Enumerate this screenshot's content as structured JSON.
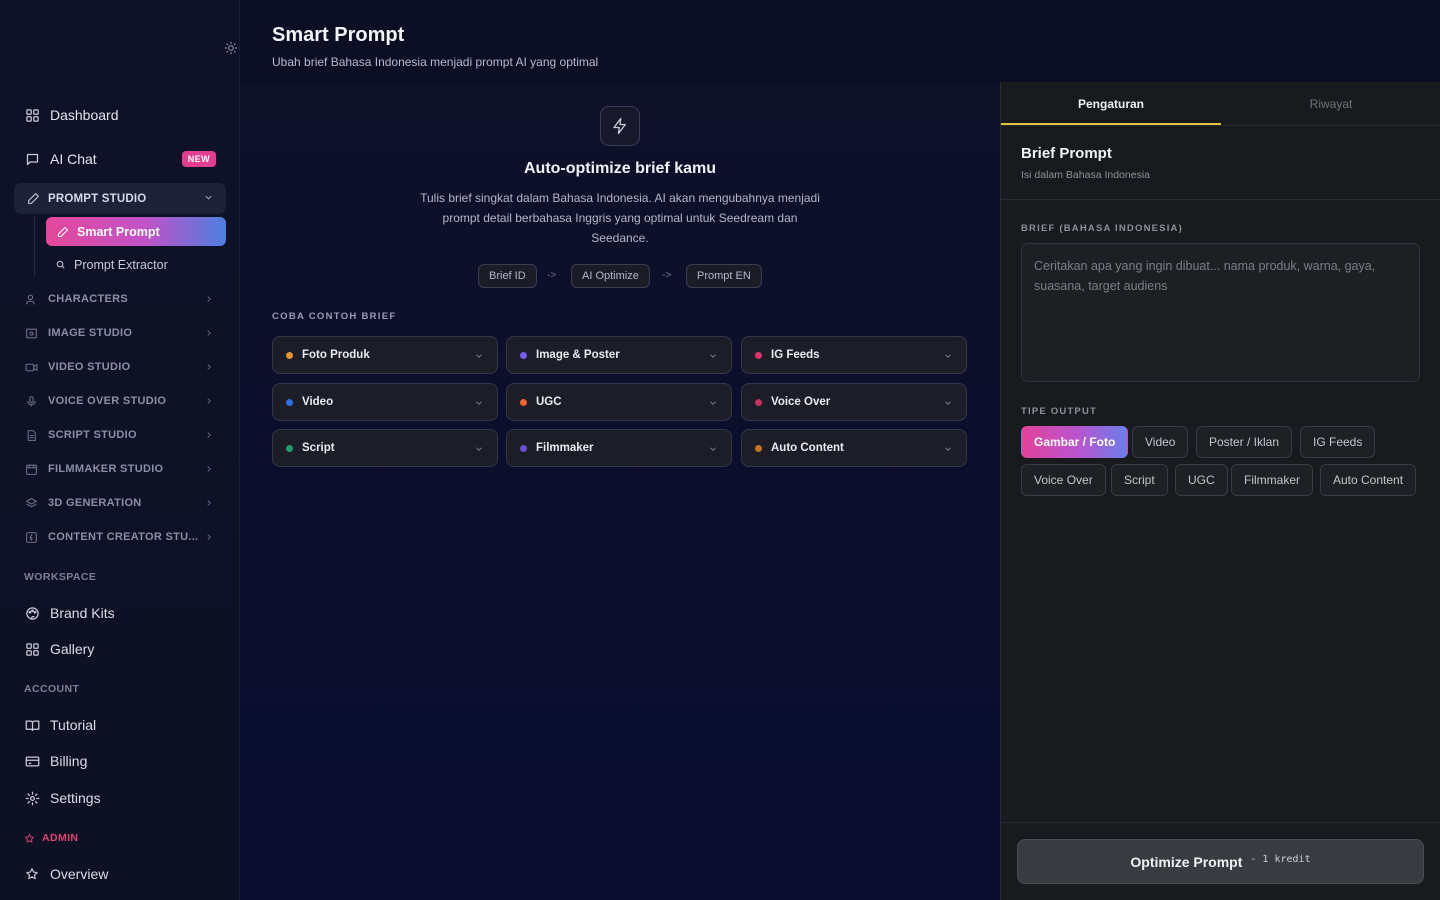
{
  "sidebar": {
    "top_items": [
      {
        "label": "Dashboard",
        "icon": "grid-icon"
      },
      {
        "label": "AI Chat",
        "icon": "chat-icon",
        "badge": "NEW"
      }
    ],
    "open_section": {
      "label": "PROMPT STUDIO",
      "children": [
        {
          "label": "Smart Prompt",
          "active": true
        },
        {
          "label": "Prompt Extractor"
        }
      ]
    },
    "sections": [
      "CHARACTERS",
      "IMAGE STUDIO",
      "VIDEO STUDIO",
      "VOICE OVER STUDIO",
      "SCRIPT STUDIO",
      "FILMMAKER STUDIO",
      "3D GENERATION",
      "CONTENT CREATOR STU..."
    ],
    "workspace": {
      "label": "WORKSPACE",
      "items": [
        "Brand Kits",
        "Gallery"
      ]
    },
    "account": {
      "label": "ACCOUNT",
      "items": [
        "Tutorial",
        "Billing",
        "Settings"
      ]
    },
    "admin": {
      "label": "ADMIN",
      "items": [
        "Overview"
      ]
    }
  },
  "header": {
    "title": "Smart Prompt",
    "subtitle": "Ubah brief Bahasa Indonesia menjadi prompt AI yang optimal"
  },
  "hero": {
    "title": "Auto-optimize brief kamu",
    "description": "Tulis brief singkat dalam Bahasa Indonesia. AI akan mengubahnya menjadi prompt detail berbahasa Inggris yang optimal untuk Seedream dan Seedance.",
    "flow": [
      "Brief ID",
      "AI Optimize",
      "Prompt EN"
    ],
    "flow_arrow": "->"
  },
  "examples": {
    "label": "COBA CONTOH BRIEF",
    "cards": [
      {
        "label": "Foto Produk",
        "color": "#e0952f"
      },
      {
        "label": "Image & Poster",
        "color": "#7a5cf0"
      },
      {
        "label": "IG Feeds",
        "color": "#e2306c"
      },
      {
        "label": "Video",
        "color": "#2f6fe0"
      },
      {
        "label": "UGC",
        "color": "#f2632e"
      },
      {
        "label": "Voice Over",
        "color": "#c7325e"
      },
      {
        "label": "Script",
        "color": "#1f9e6e"
      },
      {
        "label": "Filmmaker",
        "color": "#6a4fcf"
      },
      {
        "label": "Auto Content",
        "color": "#c2731f"
      }
    ]
  },
  "panel": {
    "tabs": [
      "Pengaturan",
      "Riwayat"
    ],
    "active_tab": "Pengaturan",
    "section_title": "Brief Prompt",
    "section_sub": "Isi dalam Bahasa Indonesia",
    "brief_label": "BRIEF (BAHASA INDONESIA)",
    "brief_value": "",
    "brief_placeholder": "Ceritakan apa yang ingin dibuat... nama produk, warna, gaya, suasana, target audiens",
    "type_label": "TIPE OUTPUT",
    "types": [
      "Gambar / Foto",
      "Video",
      "Poster / Iklan",
      "IG Feeds",
      "Voice Over",
      "Script",
      "UGC",
      "Filmmaker",
      "Auto Content"
    ],
    "selected_type": "Gambar / Foto",
    "button_label": "Optimize Prompt",
    "button_cost": "- 1 kredit"
  },
  "colors": {
    "accent_gradient_start": "#e4489a",
    "accent_gradient_end": "#4c7fe0",
    "tab_underline": "#e0c341",
    "admin": "#d9466f",
    "badge_new": "#e23d8e"
  }
}
